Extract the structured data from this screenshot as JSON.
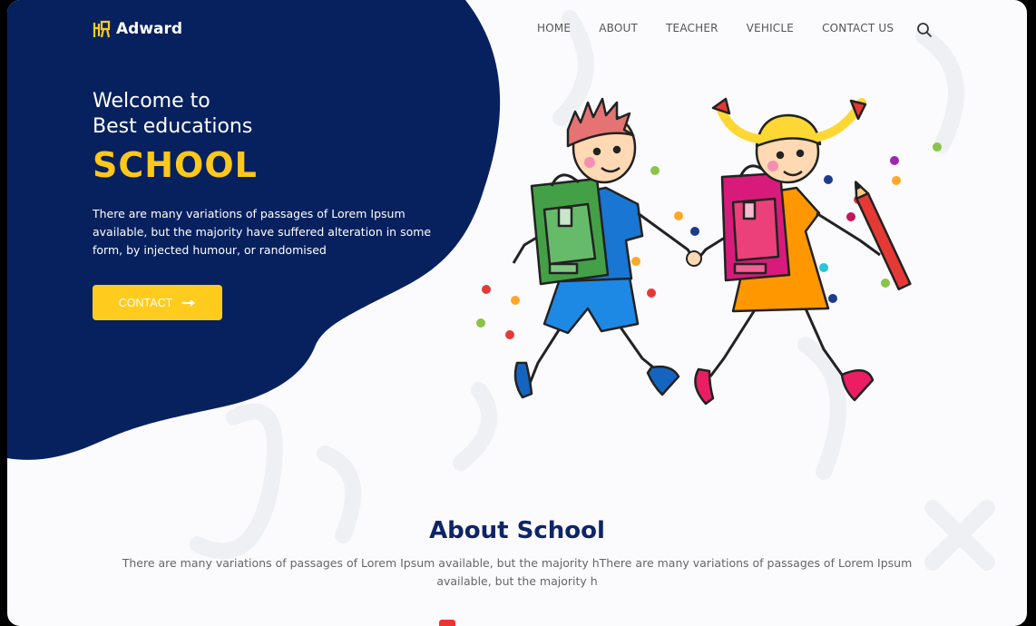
{
  "brand": {
    "name": "Adward",
    "accent": "#ffcc1d",
    "navy": "#07215f"
  },
  "nav": {
    "items": [
      {
        "label": "HOME"
      },
      {
        "label": "ABOUT"
      },
      {
        "label": "TEACHER"
      },
      {
        "label": "VEHICLE"
      },
      {
        "label": "CONTACT US"
      }
    ],
    "search_icon": "search-icon"
  },
  "hero": {
    "line1": "Welcome to",
    "line2": "Best educations",
    "highlight": "SCHOOL",
    "description": "There are many variations of passages of Lorem Ipsum available, but the majority have suffered alteration in some form, by injected humour, or randomised",
    "cta_label": "CONTACT",
    "cta_icon": "arrow-right-icon",
    "illustration": "school-kids-illustration"
  },
  "about": {
    "title": "About School",
    "description": "There are many variations of passages of Lorem Ipsum available, but the majority hThere are many variations of passages of Lorem Ipsum available, but the majority h"
  }
}
